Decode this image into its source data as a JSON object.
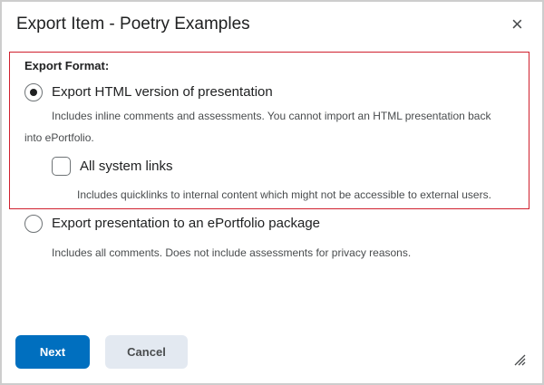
{
  "dialog": {
    "title": "Export Item - Poetry Examples",
    "close_icon": "×"
  },
  "form": {
    "label": "Export Format:",
    "options": [
      {
        "label": "Export HTML version of presentation",
        "selected": true,
        "description_line1": "Includes inline comments and assessments. You cannot import an HTML presentation back",
        "description_line2": "into ePortfolio."
      },
      {
        "label": "Export presentation to an ePortfolio package",
        "selected": false,
        "description_line1": "Includes all comments. Does not include assessments for privacy reasons."
      }
    ],
    "checkbox": {
      "label": "All system links",
      "checked": false,
      "description": "Includes quicklinks to internal content which might not be accessible to external users."
    }
  },
  "buttons": {
    "next": "Next",
    "cancel": "Cancel"
  },
  "colors": {
    "primary": "#006fbf",
    "highlight": "#d0202e"
  }
}
